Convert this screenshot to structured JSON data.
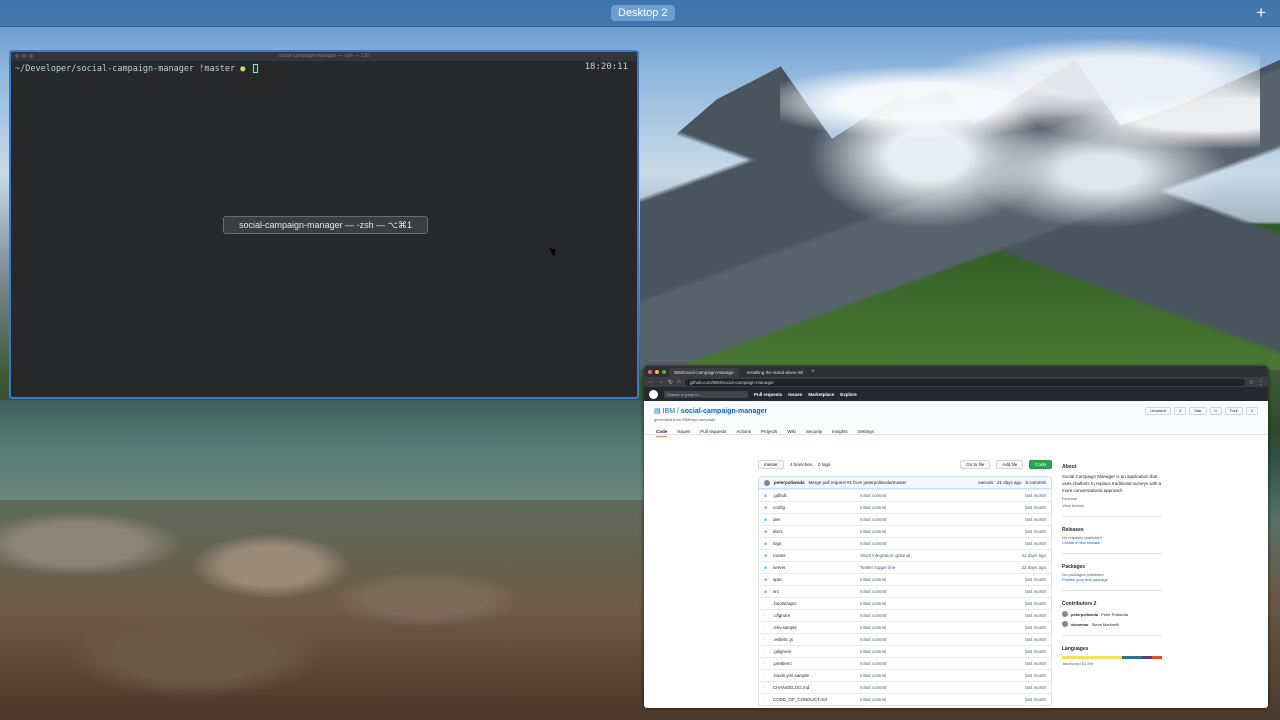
{
  "desktop": {
    "label": "Desktop 2",
    "add_icon": "plus-icon"
  },
  "terminal": {
    "title_tiny": "social-campaign-manager — -zsh — 130",
    "prompt_path": "~/Developer/social-campaign-manager",
    "branch": "master",
    "clock": "18:20:11",
    "tooltip": "social-campaign-manager — -zsh — ⌥⌘1"
  },
  "browser": {
    "tabs": [
      "IBM/social-campaign-manage",
      "Installing the stand-alone Wi"
    ],
    "url": "github.com/IBM/social-campaign-manager",
    "gh_search": "Search or jump to...",
    "gh_links": [
      "Pull requests",
      "Issues",
      "Marketplace",
      "Explore"
    ],
    "repo": {
      "owner": "IBM",
      "name": "social-campaign-manager",
      "generated": "generated from IBM/repo-template",
      "actions": [
        "Unwatch",
        "3",
        "Star",
        "0",
        "Fork",
        "2"
      ],
      "tabs": [
        "Code",
        "Issues",
        "Pull requests",
        "Actions",
        "Projects",
        "Wiki",
        "Security",
        "Insights",
        "Settings"
      ],
      "branch": "master",
      "branches": "4 branches",
      "tags": "0 tags",
      "goto": "Go to file",
      "addfile": "Add file",
      "code": "Code",
      "commit_user": "peterpoliwoda",
      "commit_msg": "Merge pull request #1 from peterpoliwoda/master",
      "commit_hash": "eaecda",
      "commit_age": "21 days ago",
      "commit_count": "8 commits",
      "files": [
        {
          "icon": "folder",
          "name": ".github",
          "msg": "Initial commit",
          "age": "last month"
        },
        {
          "icon": "folder",
          "name": "config",
          "msg": "Initial commit",
          "age": "last month"
        },
        {
          "icon": "folder",
          "name": "dev",
          "msg": "Initial commit",
          "age": "last month"
        },
        {
          "icon": "folder",
          "name": "docs",
          "msg": "Initial commit",
          "age": "last month"
        },
        {
          "icon": "folder",
          "name": "logs",
          "msg": "Initial commit",
          "age": "last month"
        },
        {
          "icon": "folder",
          "name": "routes",
          "msg": "Slack integration optional",
          "age": "22 days ago"
        },
        {
          "icon": "folder",
          "name": "server",
          "msg": "Twitter logger line",
          "age": "22 days ago"
        },
        {
          "icon": "folder",
          "name": "spec",
          "msg": "Initial commit",
          "age": "last month"
        },
        {
          "icon": "folder",
          "name": "src",
          "msg": "Initial commit",
          "age": "last month"
        },
        {
          "icon": "file",
          "name": ".bootstraprc",
          "msg": "Initial commit",
          "age": "last month"
        },
        {
          "icon": "file",
          "name": ".cfignore",
          "msg": "Initial commit",
          "age": "last month"
        },
        {
          "icon": "file",
          "name": ".env.sample",
          "msg": "Initial commit",
          "age": "last month"
        },
        {
          "icon": "file",
          "name": ".eslintrc.js",
          "msg": "Initial commit",
          "age": "last month"
        },
        {
          "icon": "file",
          "name": ".gitignore",
          "msg": "Initial commit",
          "age": "last month"
        },
        {
          "icon": "file",
          "name": ".prettierrc",
          "msg": "Initial commit",
          "age": "last month"
        },
        {
          "icon": "file",
          "name": ".travis.yml.sample",
          "msg": "Initial commit",
          "age": "last month"
        },
        {
          "icon": "file",
          "name": "CHANGELOG.md",
          "msg": "Initial commit",
          "age": "last month"
        },
        {
          "icon": "file",
          "name": "CODE_OF_CONDUCT.md",
          "msg": "Initial commit",
          "age": "last month"
        }
      ]
    },
    "about": {
      "heading": "About",
      "desc": "Social Campaign Manager is an application that uses chatbots to replace traditional surveys with a more conversational approach",
      "readme": "Readme",
      "license": "View license",
      "releases_h": "Releases",
      "releases_p": "No releases published",
      "releases_l": "Create a new release",
      "packages_h": "Packages",
      "packages_p": "No packages published",
      "packages_l": "Publish your first package",
      "contributors_h": "Contributors",
      "contributors_count": "2",
      "contributors": [
        {
          "user": "peterpoliwoda",
          "name": "Peter Poliwoda"
        },
        {
          "user": "stevemar",
          "name": "Steve Martinelli"
        }
      ],
      "languages_h": "Languages",
      "lang_first": "JavaScript 81.5%"
    }
  }
}
